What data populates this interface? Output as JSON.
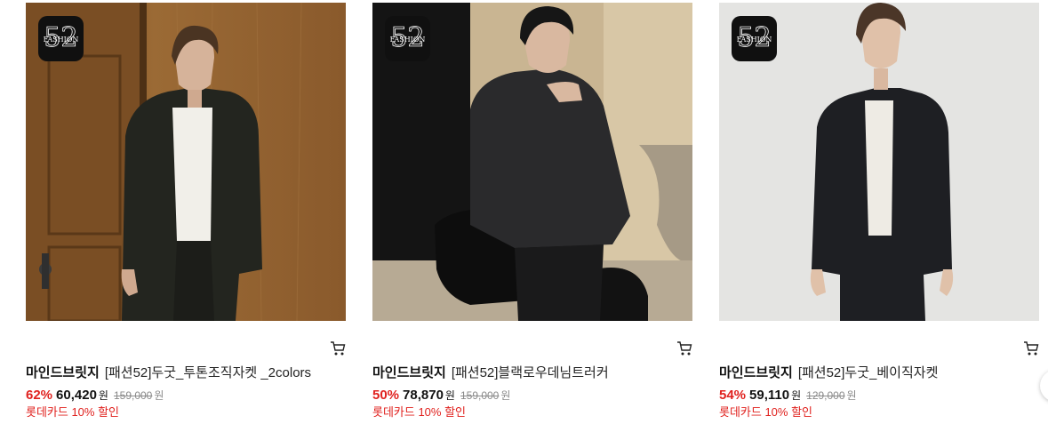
{
  "badge": {
    "top": "FASHION",
    "number": "52",
    "icon": "fashion52-logo-icon"
  },
  "currency_unit": "원",
  "products": [
    {
      "brand": "마인드브릿지",
      "name": "[패션52]두굿_투톤조직자켓 _2colors",
      "discount": "62%",
      "price": "60,420",
      "original_price": "159,000",
      "card_promo": "롯데카드 10% 할인",
      "image_desc": "model-in-dark-blazer-wood-door"
    },
    {
      "brand": "마인드브릿지",
      "name": "[패션52]블랙로우데님트러커",
      "discount": "50%",
      "price": "78,870",
      "original_price": "159,000",
      "card_promo": "롯데카드 10% 할인",
      "image_desc": "model-in-black-denim-trucker-jacket"
    },
    {
      "brand": "마인드브릿지",
      "name": "[패션52]두굿_베이직자켓",
      "discount": "54%",
      "price": "59,110",
      "original_price": "129,000",
      "card_promo": "롯데카드 10% 할인",
      "image_desc": "model-in-black-basic-blazer-grey-studio"
    }
  ],
  "colors": {
    "discount": "#e0211e",
    "promo": "#e0211e",
    "strike": "#8a8a8a"
  }
}
